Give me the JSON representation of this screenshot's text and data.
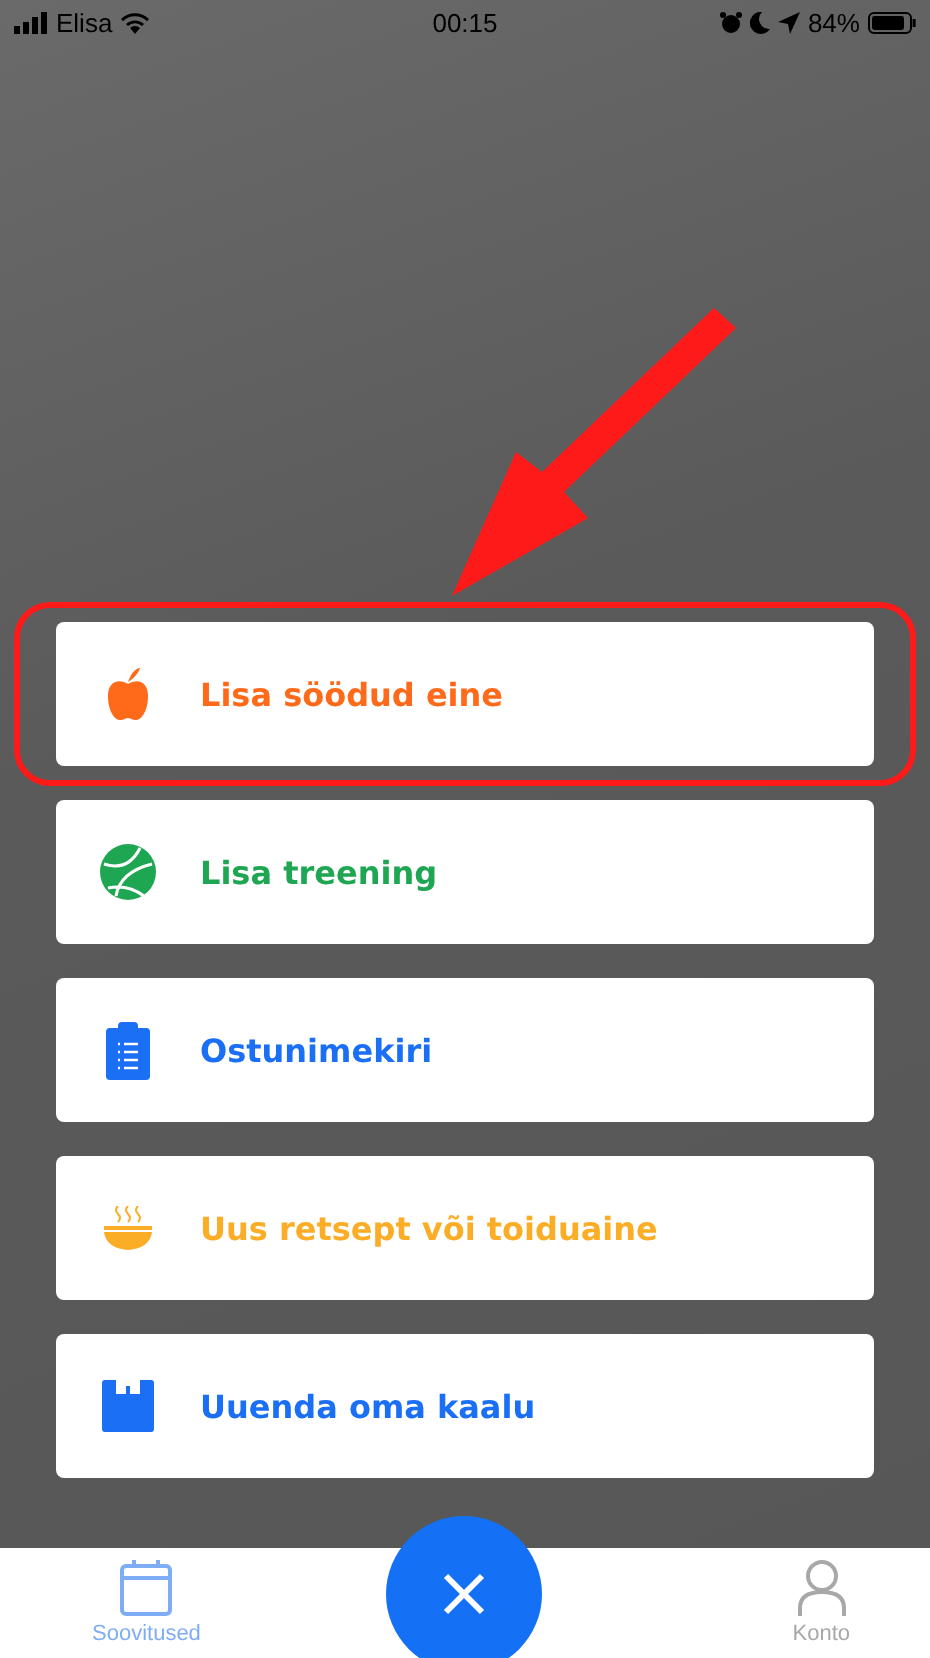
{
  "status_bar": {
    "carrier": "Elisa",
    "time": "00:15",
    "battery": "84%"
  },
  "menu_items": [
    {
      "label": "Lisa söödud eine",
      "kind": "meal",
      "color": "#ff6a1a",
      "highlighted": true
    },
    {
      "label": "Lisa treening",
      "kind": "exercise",
      "color": "#1fa653",
      "highlighted": false
    },
    {
      "label": "Ostunimekiri",
      "kind": "list",
      "color": "#1a6ff5",
      "highlighted": false
    },
    {
      "label": "Uus retsept või toiduaine",
      "kind": "recipe",
      "color": "#fbad26",
      "highlighted": false
    },
    {
      "label": "Uuenda oma kaalu",
      "kind": "weight",
      "color": "#1a6ff5",
      "highlighted": false
    }
  ],
  "tab_bar": [
    {
      "label": "Soovitused",
      "kind": "calendar",
      "selected": true
    },
    {
      "label": "Konto",
      "kind": "person",
      "selected": false
    }
  ]
}
